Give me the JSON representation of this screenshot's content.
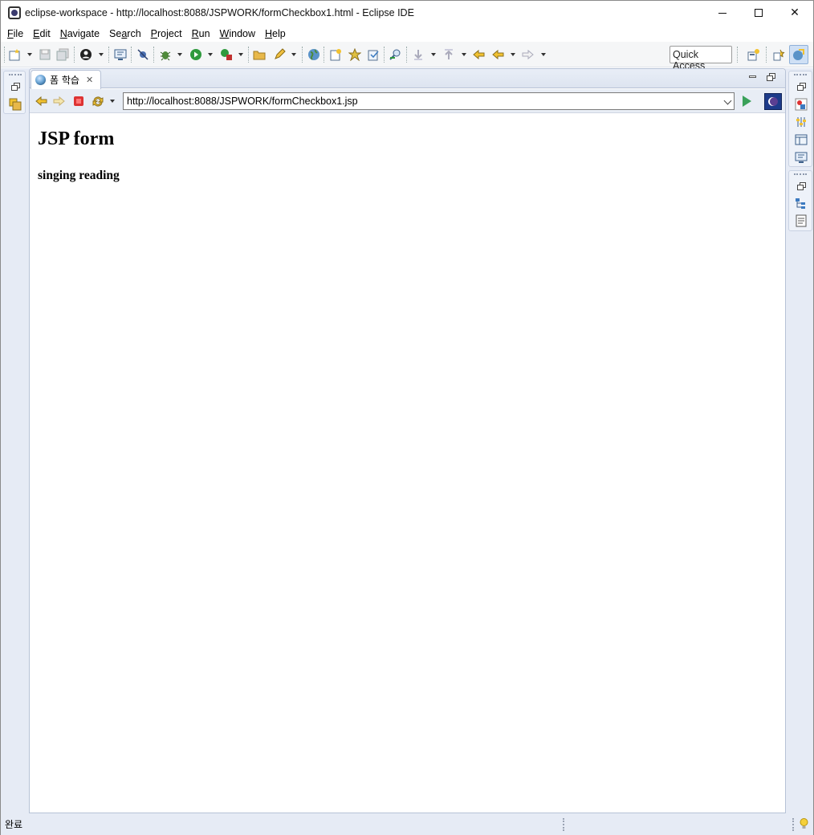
{
  "window": {
    "title": "eclipse-workspace - http://localhost:8088/JSPWORK/formCheckbox1.html - Eclipse IDE"
  },
  "menu": [
    {
      "pre": "",
      "mn": "F",
      "post": "ile"
    },
    {
      "pre": "",
      "mn": "E",
      "post": "dit"
    },
    {
      "pre": "",
      "mn": "N",
      "post": "avigate"
    },
    {
      "pre": "Se",
      "mn": "a",
      "post": "rch"
    },
    {
      "pre": "",
      "mn": "P",
      "post": "roject"
    },
    {
      "pre": "",
      "mn": "R",
      "post": "un"
    },
    {
      "pre": "",
      "mn": "W",
      "post": "indow"
    },
    {
      "pre": "",
      "mn": "H",
      "post": "elp"
    }
  ],
  "toolbar": {
    "quick_access": "Quick Access"
  },
  "editor": {
    "tab_label": "폼 학습",
    "url": "http://localhost:8088/JSPWORK/formCheckbox1.jsp"
  },
  "page": {
    "heading": "JSP form",
    "result": "singing reading"
  },
  "status": {
    "text": "완료"
  },
  "colors": {
    "workbench_bg": "#e6ebf5",
    "go_green": "#3aa15a"
  }
}
